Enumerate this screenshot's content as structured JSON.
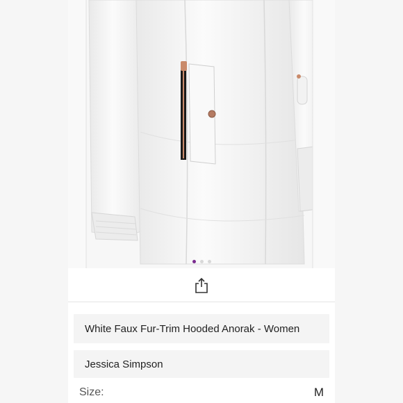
{
  "listing": {
    "title": "White Faux Fur-Trim Hooded Anorak - Women",
    "brand": "Jessica Simpson",
    "size_label": "Size:",
    "size_value": "M"
  },
  "carousel": {
    "image_count": 3,
    "active_index": 0
  },
  "icons": {
    "share": "share-icon"
  },
  "colors": {
    "accent_dot": "#7a2b8f",
    "card_bg": "#f4f4f4"
  }
}
